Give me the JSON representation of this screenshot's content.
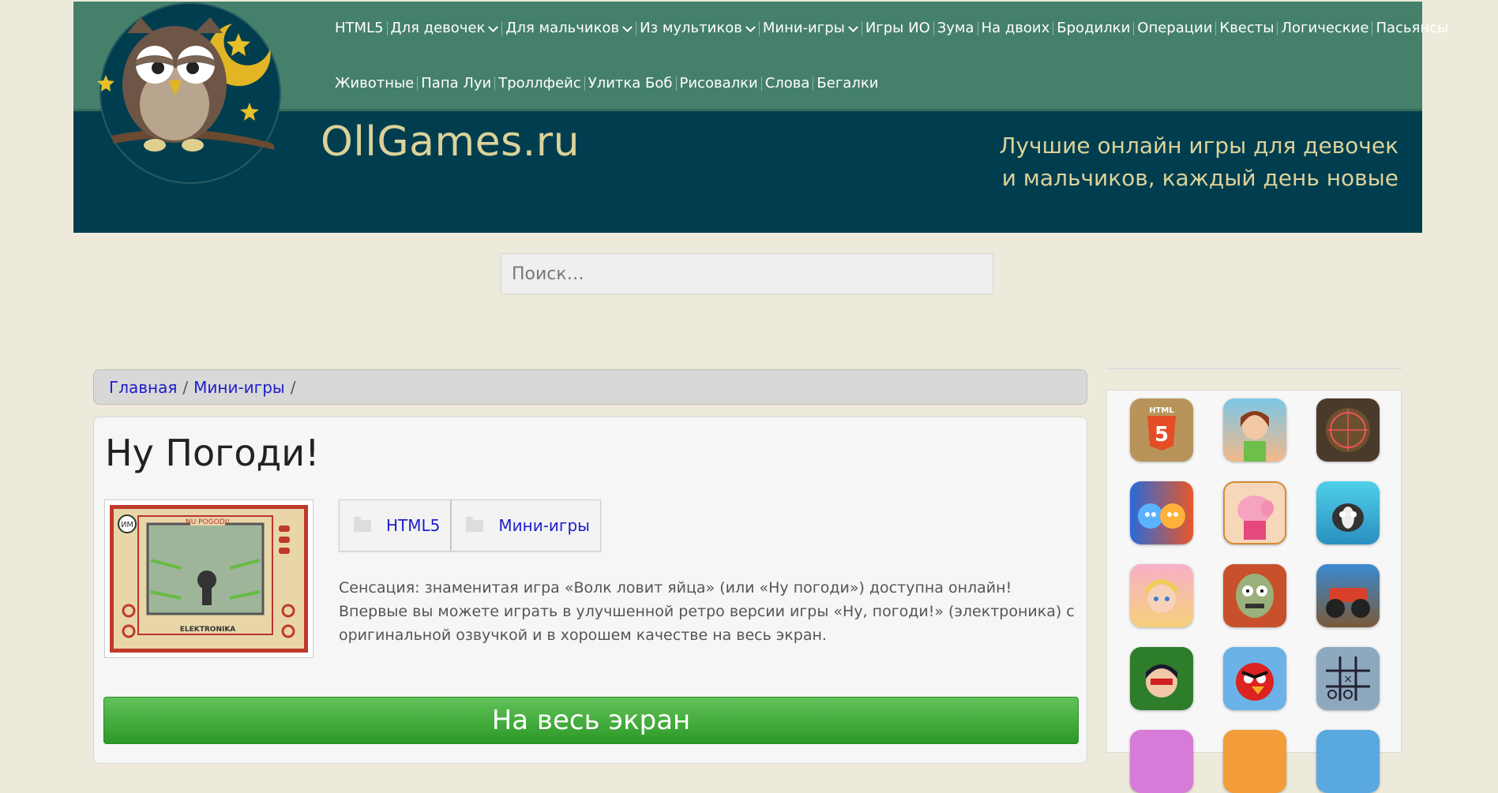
{
  "site": {
    "name": "OllGames.ru",
    "tagline": "Лучшие онлайн игры для девочек и мальчиков, каждый день новые"
  },
  "nav": {
    "row1": [
      {
        "label": "HTML5",
        "dropdown": false
      },
      {
        "label": "Для девочек",
        "dropdown": true
      },
      {
        "label": "Для мальчиков",
        "dropdown": true
      },
      {
        "label": "Из мультиков",
        "dropdown": true
      },
      {
        "label": "Мини-игры",
        "dropdown": true
      },
      {
        "label": "Игры ИО",
        "dropdown": false
      },
      {
        "label": "Зума",
        "dropdown": false
      },
      {
        "label": "На двоих",
        "dropdown": false
      },
      {
        "label": "Бродилки",
        "dropdown": false
      },
      {
        "label": "Операции",
        "dropdown": false
      },
      {
        "label": "Квесты",
        "dropdown": false
      },
      {
        "label": "Логические",
        "dropdown": false
      },
      {
        "label": "Пасьянсы",
        "dropdown": false
      }
    ],
    "row2": [
      {
        "label": "Животные"
      },
      {
        "label": "Папа Луи"
      },
      {
        "label": "Троллфейс"
      },
      {
        "label": "Улитка Боб"
      },
      {
        "label": "Рисовалки"
      },
      {
        "label": "Слова"
      },
      {
        "label": "Бегалки"
      }
    ]
  },
  "search": {
    "placeholder": "Поиск…"
  },
  "breadcrumb": {
    "home": "Главная",
    "section": "Мини-игры",
    "sep": "/"
  },
  "game": {
    "title": "Ну Погоди!",
    "categories": [
      "HTML5",
      "Мини-игры"
    ],
    "description": "Сенсация: знаменитая игра «Волк ловит яйца» (или «Ну погоди») доступна онлайн! Впервые вы можете играть в улучшенной ретро версии игры «Ну, погоди!» (электроника) с оригинальной озвучкой и в хорошем качестве на весь экран.",
    "thumb_top_text": "NU POGODI!",
    "thumb_bottom_text": "ELEKTRONIKA",
    "fullscreen_label": "На весь экран"
  },
  "sidebar": {
    "html5_badge": "HTML",
    "html5_number": "5",
    "icons": [
      "html5-icon",
      "princess-icon",
      "sniper-icon",
      "fire-water-icon",
      "peppa-icon",
      "skunk-icon",
      "doll-icon",
      "zombie-icon",
      "monster-truck-icon",
      "ladybug-icon",
      "angry-bird-icon",
      "tic-tac-toe-icon"
    ]
  },
  "colors": {
    "nav_bg": "#45806a",
    "header_bg": "#003e4f",
    "accent_text": "#dcd29a",
    "link": "#1d1dcc",
    "button_green": "#3aa932"
  }
}
